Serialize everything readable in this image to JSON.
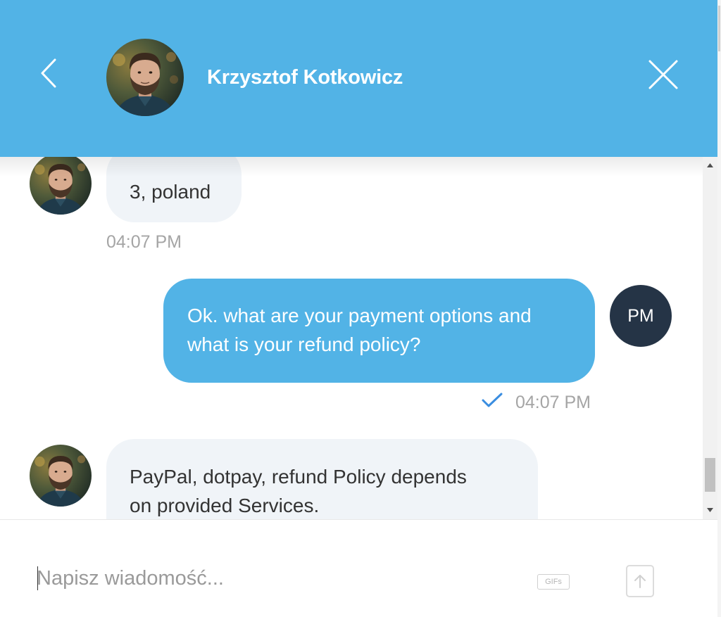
{
  "header": {
    "contact_name": "Krzysztof Kotkowicz",
    "background_color": "#52b3e6",
    "back_icon": "chevron-left-icon",
    "close_icon": "close-icon"
  },
  "messages": [
    {
      "direction": "incoming",
      "text": "3, poland",
      "time": "04:07 PM"
    },
    {
      "direction": "outgoing",
      "text_lines": [
        "Ok. what are your payment options and",
        "what is your refund policy?"
      ],
      "time": "04:07 PM",
      "status_icon": "checkmark-icon",
      "avatar_initials": "PM"
    },
    {
      "direction": "incoming",
      "text_lines": [
        "PayPal, dotpay, refund Policy depends",
        "on provided Services."
      ]
    }
  ],
  "composer": {
    "placeholder": "Napisz wiadomość...",
    "gifs_label": "GIFs",
    "send_icon": "arrow-up-icon"
  },
  "colors": {
    "accent": "#52b3e6",
    "incoming_bubble": "#f0f4f8",
    "user_avatar": "#253446",
    "check": "#3a8de0",
    "timestamp": "#a5a5a5"
  }
}
